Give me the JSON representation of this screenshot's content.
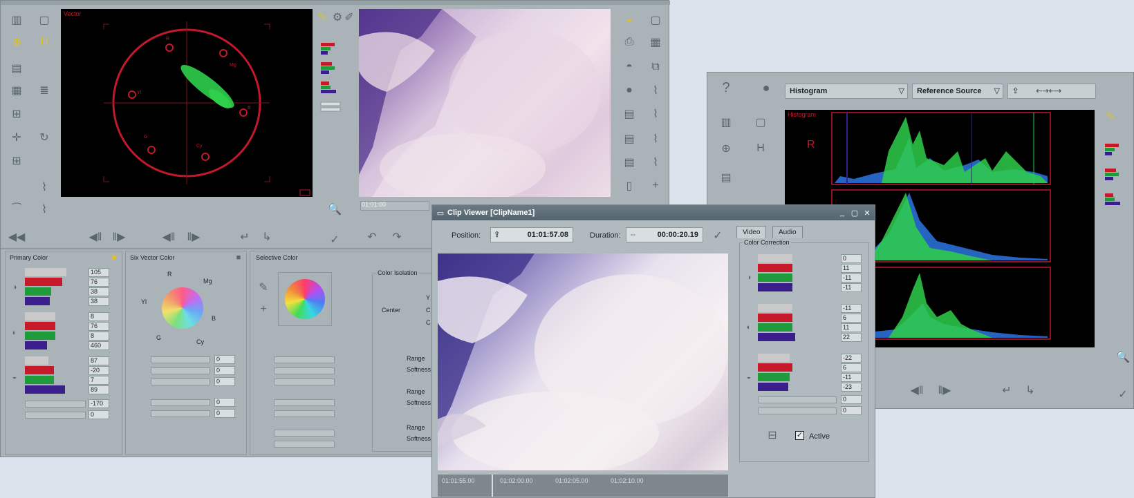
{
  "vector_window": {
    "scope_label": "Vector",
    "scope_markers": [
      "R",
      "Mg",
      "B",
      "Cy",
      "G",
      "Yl"
    ],
    "primary_color": {
      "title": "Primary Color",
      "values": [
        "105",
        "76",
        "38",
        "38",
        "8",
        "76",
        "8",
        "460",
        "87",
        "-20",
        "7",
        "89",
        "-170",
        "0"
      ]
    },
    "six_vector_color": {
      "title": "Six Vector Color",
      "wheel_labels": [
        "R",
        "Mg",
        "B",
        "Cy",
        "G",
        "Yl"
      ],
      "values": [
        "0",
        "0",
        "0",
        "0",
        "0"
      ]
    },
    "selective_color": {
      "title": "Selective Color",
      "color_isolation_label": "Color Isolation",
      "center_label": "Center",
      "ys": [
        "Y",
        "C",
        "C"
      ],
      "range_labels": [
        "Range",
        "Softness",
        "Range",
        "Softness",
        "Range",
        "Softness"
      ]
    },
    "timecode": "01:01:00"
  },
  "histogram_window": {
    "dropdown_histogram": "Histogram",
    "dropdown_reference": "Reference Source",
    "title": "Histogram",
    "channel": "R"
  },
  "clip_viewer": {
    "title": "Clip Viewer [ClipName1]",
    "position_label": "Position:",
    "position_value": "01:01:57.08",
    "duration_label": "Duration:",
    "duration_value": "00:00:20.19",
    "tabs": [
      "Video",
      "Audio"
    ],
    "color_correction_label": "Color Correction",
    "cc_values": [
      "0",
      "11",
      "-11",
      "-11",
      "-11",
      "6",
      "11",
      "22",
      "-22",
      "6",
      "-11",
      "-23",
      "0",
      "0"
    ],
    "active_label": "Active",
    "timeline": [
      "01:01:55.00",
      "01:02:00.00",
      "01:02:05.00",
      "01:02:10.00"
    ]
  },
  "colors": {
    "scope_red": "#c0192b",
    "scope_green": "#2ecf4a",
    "bar_red": "#c8192b",
    "bar_green": "#1f9b3c",
    "bar_blue": "#3a1f8c",
    "bar_gray": "#c9c9c9"
  }
}
